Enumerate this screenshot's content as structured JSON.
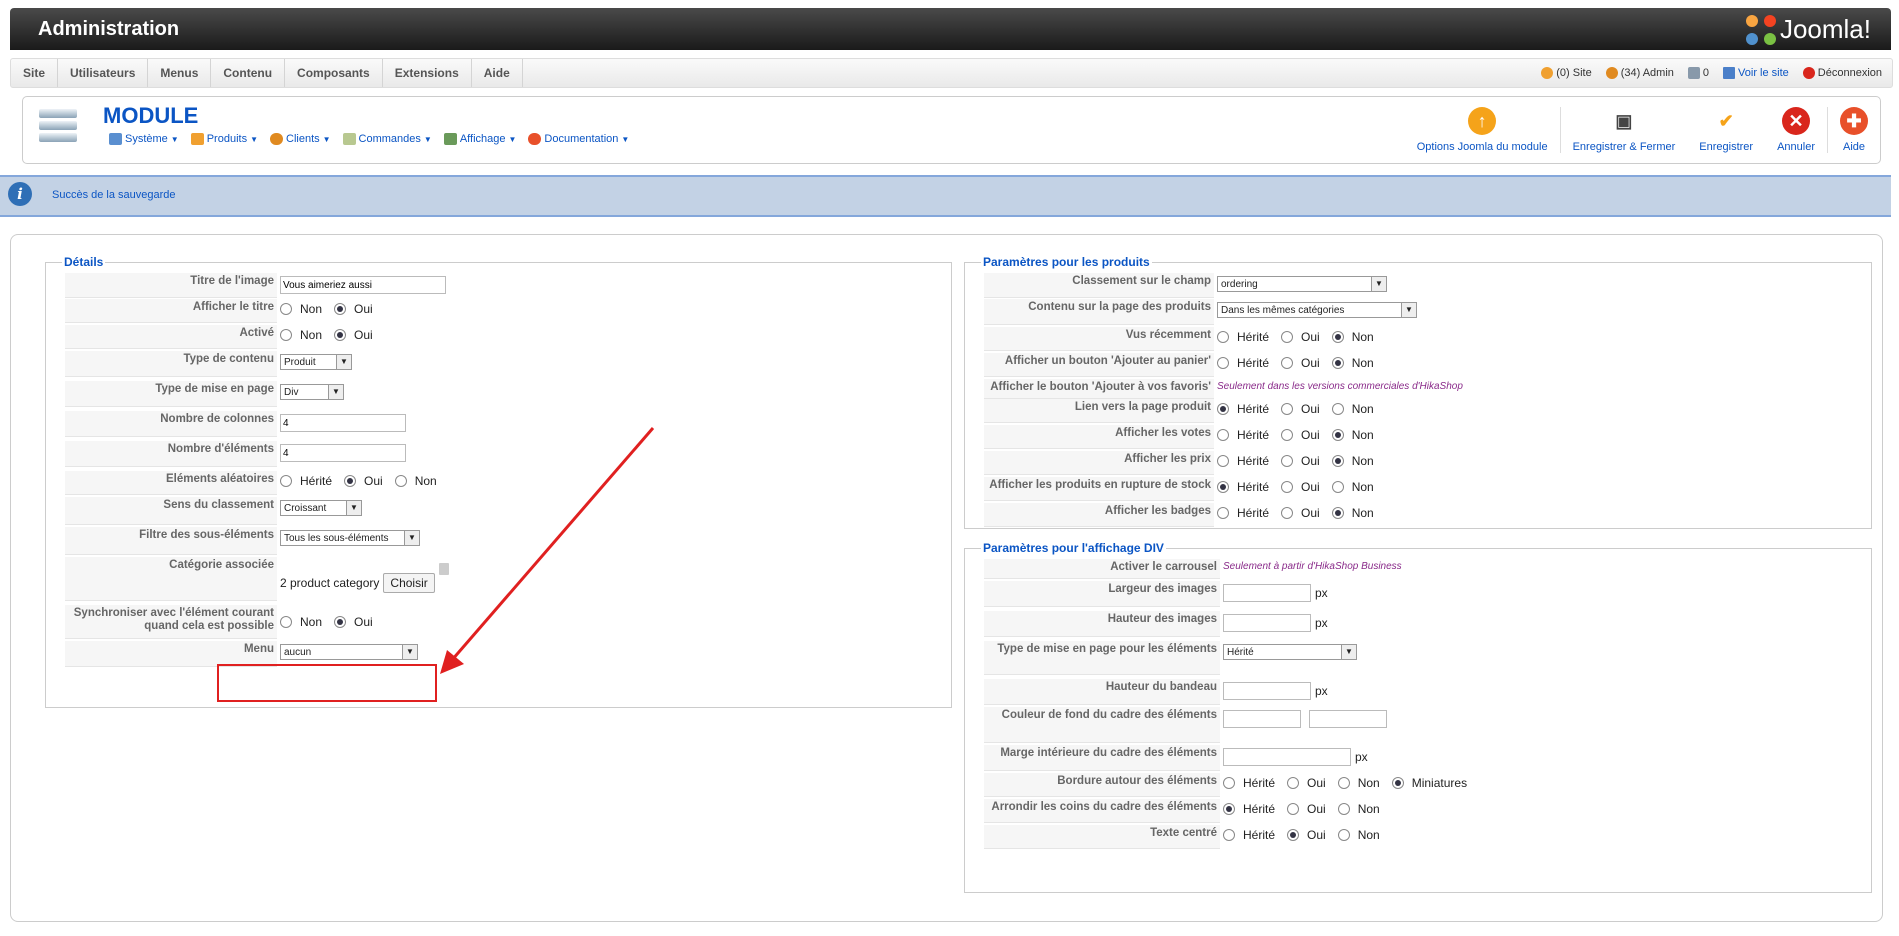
{
  "app": {
    "title": "Administration",
    "logo_text": "Joomla!"
  },
  "menubar": {
    "items": [
      "Site",
      "Utilisateurs",
      "Menus",
      "Contenu",
      "Composants",
      "Extensions",
      "Aide"
    ],
    "status": {
      "site": "(0) Site",
      "admin": "(34) Admin",
      "messages": "0",
      "view_site": "Voir le site",
      "logout": "Déconnexion"
    }
  },
  "toolbar": {
    "page_title": "MODULE",
    "submenu": [
      "Système",
      "Produits",
      "Clients",
      "Commandes",
      "Affichage",
      "Documentation"
    ],
    "buttons": {
      "options": "Options Joomla du module",
      "save_close": "Enregistrer & Fermer",
      "save": "Enregistrer",
      "cancel": "Annuler",
      "help": "Aide"
    }
  },
  "message": "Succès de la sauvegarde",
  "details": {
    "legend": "Détails",
    "labels": {
      "image_title": "Titre de l'image",
      "show_title": "Afficher le titre",
      "active": "Activé",
      "content_type": "Type de contenu",
      "layout_type": "Type de mise en page",
      "columns": "Nombre de colonnes",
      "elements": "Nombre d'éléments",
      "random": "Eléments aléatoires",
      "order_dir": "Sens du classement",
      "filter": "Filtre des sous-éléments",
      "category": "Catégorie associée",
      "sync_1": "Synchroniser avec l'élément courant",
      "sync_2": "quand cela est possible",
      "menu": "Menu"
    },
    "values": {
      "image_title": "Vous aimeriez aussi",
      "content_type": "Produit",
      "layout_type": "Div",
      "columns": "4",
      "elements": "4",
      "order_dir": "Croissant",
      "filter": "Tous les sous-éléments",
      "category": "2 product category",
      "choose": "Choisir",
      "menu": "aucun"
    },
    "opts": {
      "non": "Non",
      "oui": "Oui",
      "herite": "Hérité"
    }
  },
  "products": {
    "legend": "Paramètres pour les produits",
    "labels": {
      "order_field": "Classement sur le champ",
      "page_content": "Contenu sur la page des produits",
      "recently": "Vus récemment",
      "cart_btn": "Afficher un bouton 'Ajouter au panier'",
      "fav_btn": "Afficher le bouton 'Ajouter à vos favoris'",
      "link": "Lien vers la page produit",
      "votes": "Afficher les votes",
      "prices": "Afficher les prix",
      "out_of_stock": "Afficher les produits en rupture de stock",
      "badges": "Afficher les badges"
    },
    "values": {
      "order_field": "ordering",
      "page_content": "Dans les mêmes catégories",
      "fav_note": "Seulement dans les versions commerciales d'HikaShop"
    }
  },
  "div": {
    "legend": "Paramètres pour l'affichage DIV",
    "labels": {
      "carousel": "Activer le carrousel",
      "img_width": "Largeur des images",
      "img_height": "Hauteur des images",
      "layout_el": "Type de mise en page pour les éléments",
      "banner_h": "Hauteur du bandeau",
      "bg_color": "Couleur de fond du cadre des éléments",
      "padding": "Marge intérieure du cadre des éléments",
      "border": "Bordure autour des éléments",
      "rounded": "Arrondir les coins du cadre des éléments",
      "centered": "Texte centré"
    },
    "values": {
      "carousel_note": "Seulement à partir d'HikaShop Business",
      "px": "px",
      "layout_el": "Hérité",
      "miniatures": "Miniatures"
    }
  }
}
